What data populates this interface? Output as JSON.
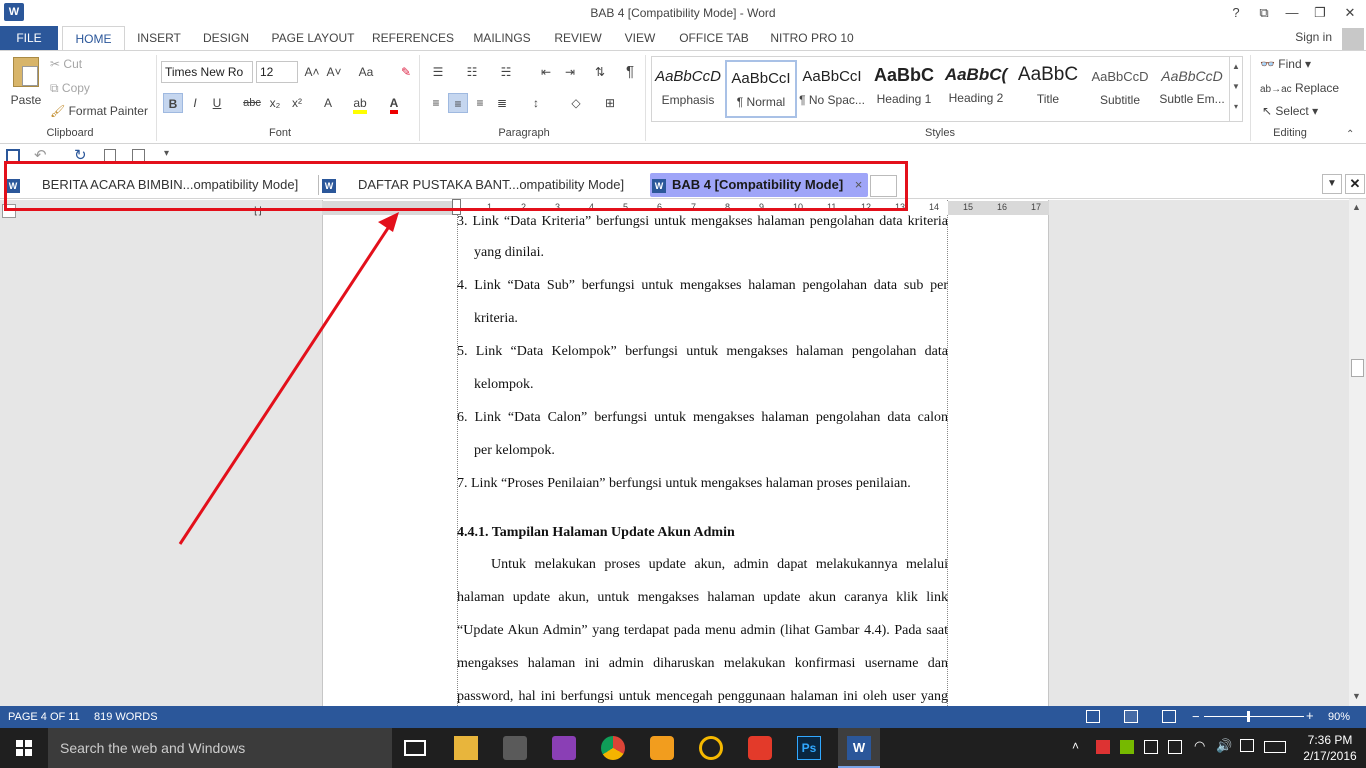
{
  "app": {
    "title": "BAB 4 [Compatibility Mode] - Word",
    "logo": "W"
  },
  "window_controls": {
    "help": "?",
    "ribbon_display": "⧉",
    "minimize": "—",
    "restore": "❐",
    "close": "✕"
  },
  "ribbon_tabs": [
    "FILE",
    "HOME",
    "INSERT",
    "DESIGN",
    "PAGE LAYOUT",
    "REFERENCES",
    "MAILINGS",
    "REVIEW",
    "VIEW",
    "OFFICE TAB",
    "NITRO PRO 10"
  ],
  "account": {
    "signin": "Sign in"
  },
  "clipboard": {
    "paste": "Paste",
    "cut": "Cut",
    "copy": "Copy",
    "format_painter": "Format Painter",
    "label": "Clipboard"
  },
  "font": {
    "name": "Times New Ro",
    "size": "12",
    "bold": "B",
    "italic": "I",
    "underline": "U",
    "strike": "abc",
    "sub": "x₂",
    "sup": "x²",
    "grow": "A˄",
    "shrink": "A˅",
    "case": "Aa",
    "clear": "✎",
    "label": "Font"
  },
  "paragraph": {
    "label": "Paragraph",
    "pilcrow": "¶"
  },
  "styles": {
    "label": "Styles",
    "items": [
      {
        "preview": "AaBbCcD",
        "name": "Emphasis"
      },
      {
        "preview": "AaBbCcI",
        "name": "¶ Normal"
      },
      {
        "preview": "AaBbCcI",
        "name": "¶ No Spac..."
      },
      {
        "preview": "AaBbC",
        "name": "Heading 1"
      },
      {
        "preview": "AaBbC(",
        "name": "Heading 2"
      },
      {
        "preview": "AaBbC",
        "name": "Title"
      },
      {
        "preview": "AaBbCcD",
        "name": "Subtitle"
      },
      {
        "preview": "AaBbCcD",
        "name": "Subtle Em..."
      }
    ]
  },
  "editing": {
    "find": "Find",
    "replace": "Replace",
    "select": "Select",
    "label": "Editing"
  },
  "doc_tabs": [
    {
      "label": "BERITA ACARA BIMBIN...ompatibility Mode]"
    },
    {
      "label": "DAFTAR PUSTAKA BANT...ompatibility Mode]"
    },
    {
      "label": "BAB 4 [Compatibility Mode]",
      "close": "×"
    }
  ],
  "ruler": {
    "ticks": [
      "1",
      "2",
      "3",
      "4",
      "5",
      "6",
      "7",
      "8",
      "9",
      "10",
      "11",
      "12",
      "13",
      "14",
      "15",
      "16",
      "17"
    ]
  },
  "document": {
    "lines": [
      {
        "text": "3. Link “Data Kriteria” berfungsi untuk mengakses halaman pengolahan data kriteria"
      },
      {
        "text": "yang dinilai."
      },
      {
        "text": "4. Link “Data Sub” berfungsi untuk mengakses halaman pengolahan data sub per"
      },
      {
        "text": "kriteria."
      },
      {
        "text": "5. Link “Data Kelompok” berfungsi untuk mengakses halaman pengolahan data"
      },
      {
        "text": "kelompok."
      },
      {
        "text": "6. Link “Data Calon” berfungsi untuk mengakses halaman pengolahan data calon"
      },
      {
        "text": "per kelompok."
      },
      {
        "text": "7. Link “Proses Penilaian” berfungsi untuk mengakses halaman proses penilaian."
      },
      {
        "text": "4.4.1. Tampilan Halaman Update Akun Admin"
      },
      {
        "text": "Untuk melakukan proses update akun, admin dapat melakukannya melalui"
      },
      {
        "text": "halaman update akun, untuk mengakses halaman update akun caranya klik link"
      },
      {
        "text": "“Update Akun Admin” yang terdapat pada menu admin (lihat Gambar 4.4). Pada saat"
      },
      {
        "text": "mengakses halaman ini admin diharuskan melakukan konfirmasi username dan"
      },
      {
        "text": "password, hal ini berfungsi untuk mencegah penggunaan halaman ini oleh user yang"
      }
    ]
  },
  "status": {
    "page": "PAGE 4 OF 11",
    "words": "819 WORDS",
    "zoom": "90%",
    "zoom_level": 0.9
  },
  "taskbar": {
    "search_placeholder": "Search the web and Windows",
    "time": "7:36 PM",
    "date": "2/17/2016"
  },
  "colors": {
    "accent": "#2b579a",
    "annotation": "#e3101b",
    "active_doc_tab": "#9fa5f8"
  }
}
